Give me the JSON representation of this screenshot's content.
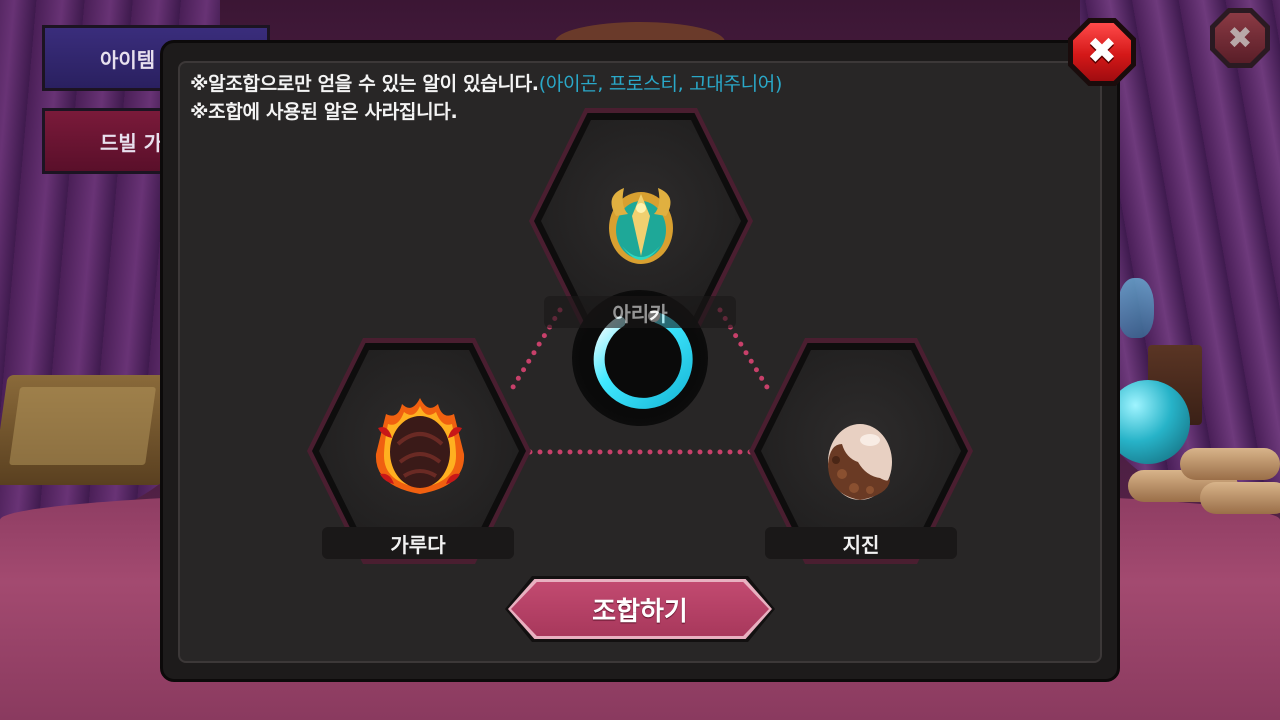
{
  "background": {
    "side_buttons": [
      {
        "label": "아이템 코"
      },
      {
        "label": "드빌 가"
      }
    ],
    "close_label": "✖"
  },
  "popup": {
    "notice_line1": "※알조합으로만 얻을 수 있는 알이 있습니다.",
    "notice_line1_highlight": "(아이곤, 프로스티, 고대주니어)",
    "notice_line2": "※조합에 사용된 알은 사라집니다.",
    "close_label": "✖",
    "slots": {
      "top": {
        "name": "아리카",
        "icon": "teal-gold-crest-egg-icon"
      },
      "left": {
        "name": "가루다",
        "icon": "flame-claw-egg-icon"
      },
      "right": {
        "name": "지진",
        "icon": "cracked-rock-egg-icon"
      }
    },
    "combine_button": "조합하기"
  },
  "colors": {
    "highlight": "#2aa8c8",
    "connector": "#c8406a",
    "loader": "#28d8f0",
    "combine_button": "#b03e64",
    "close_button": "#e02020"
  }
}
